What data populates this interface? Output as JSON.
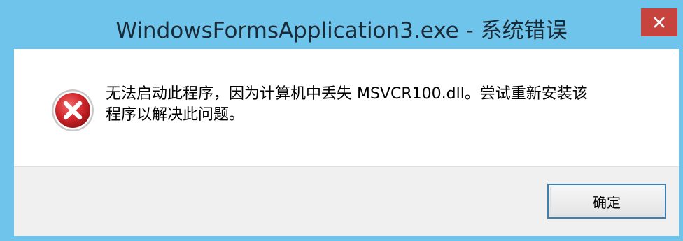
{
  "window": {
    "title": "WindowsFormsApplication3.exe - 系统错误",
    "close_glyph": "✕"
  },
  "dialog": {
    "icon": "error-icon",
    "message_line1": "无法启动此程序，因为计算机中丢失 MSVCR100.dll。尝试重新安装该",
    "message_line2": "程序以解决此问题。",
    "ok_label": "确定"
  },
  "colors": {
    "frame": "#6fc4ec",
    "close_button": "#c7433e",
    "footer": "#f0f0f0",
    "error_red": "#d0262b"
  }
}
